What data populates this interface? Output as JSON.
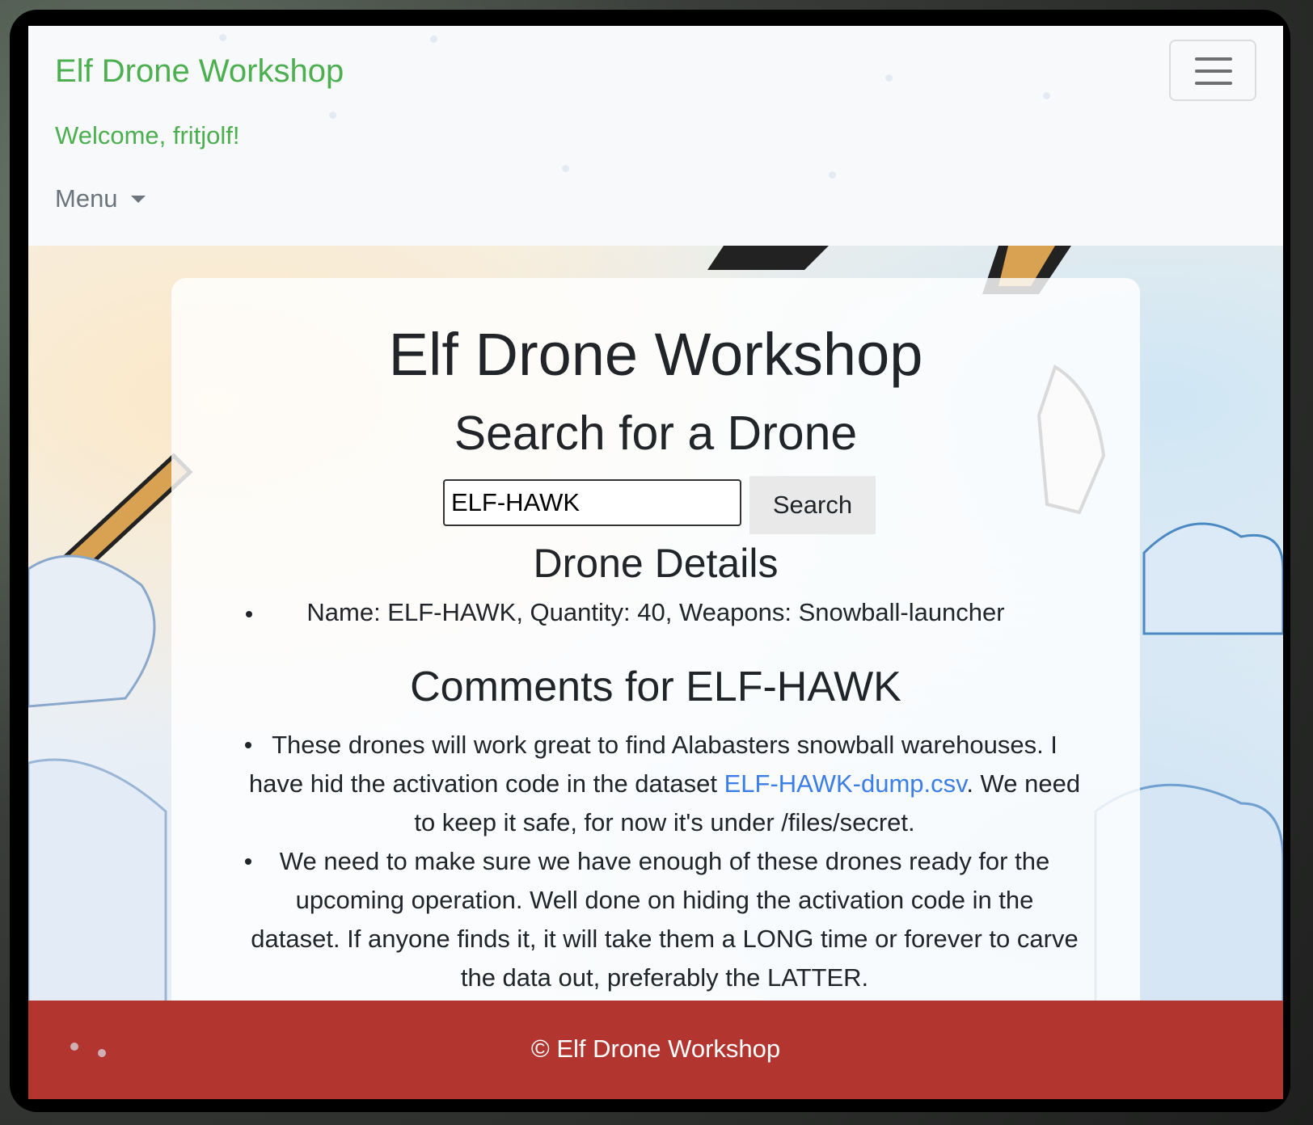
{
  "navbar": {
    "brand": "Elf Drone Workshop",
    "welcome": "Welcome, fritjolf!",
    "menu_label": "Menu"
  },
  "main": {
    "title": "Elf Drone Workshop",
    "search_heading": "Search for a Drone",
    "search_value": "ELF-HAWK",
    "search_button": "Search",
    "details_heading": "Drone Details",
    "details_item": "Name: ELF-HAWK, Quantity: 40, Weapons: Snowball-launcher",
    "comments_heading": "Comments for ELF-HAWK",
    "comment1_before": "These drones will work great to find Alabasters snowball warehouses. I have hid the activation code in the dataset ",
    "comment1_link": "ELF-HAWK-dump.csv",
    "comment1_after": ". We need to keep it safe, for now it's under /files/secret.",
    "comment2": "We need to make sure we have enough of these drones ready for the upcoming operation. Well done on hiding the activation code in the dataset. If anyone finds it, it will take them a LONG time or forever to carve the data out, preferably the LATTER."
  },
  "footer": {
    "text": "© Elf Drone Workshop"
  },
  "colors": {
    "brand_green": "#4caf50",
    "footer_red": "#b23530",
    "link_blue": "#3b7ee8"
  },
  "icons": [
    "hamburger-icon",
    "caret-down-icon"
  ]
}
